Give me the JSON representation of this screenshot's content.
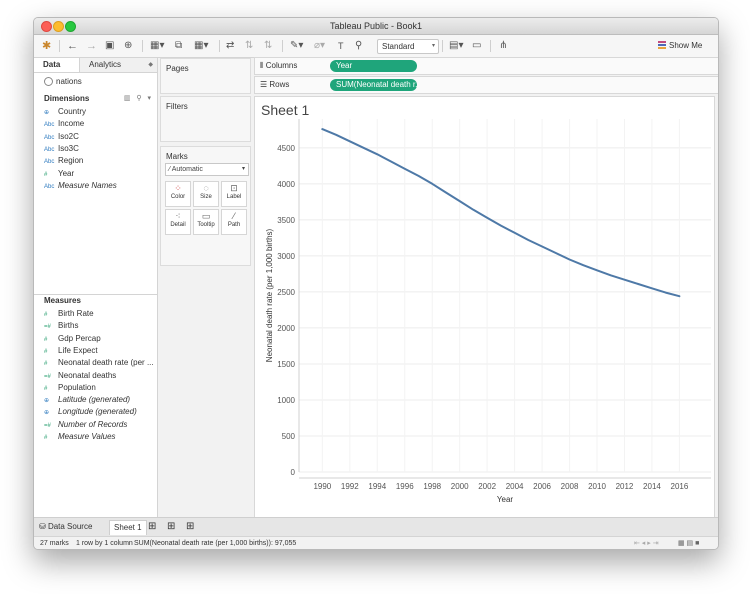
{
  "window": {
    "title": "Tableau Public - Book1"
  },
  "toolbar": {
    "view_size": "Standard",
    "show_me": "Show Me"
  },
  "data_pane": {
    "tabs": [
      "Data",
      "Analytics"
    ],
    "datasource": "nations",
    "dimensions_label": "Dimensions",
    "dimensions": [
      {
        "icon": "globe",
        "label": "Country"
      },
      {
        "icon": "Abc",
        "label": "Income"
      },
      {
        "icon": "Abc",
        "label": "Iso2C"
      },
      {
        "icon": "Abc",
        "label": "Iso3C"
      },
      {
        "icon": "Abc",
        "label": "Region"
      },
      {
        "icon": "#",
        "label": "Year"
      },
      {
        "icon": "Abc",
        "label": "Measure Names"
      }
    ],
    "measures_label": "Measures",
    "measures": [
      {
        "icon": "#",
        "label": "Birth Rate"
      },
      {
        "icon": "=#",
        "label": "Births"
      },
      {
        "icon": "#",
        "label": "Gdp Percap"
      },
      {
        "icon": "#",
        "label": "Life Expect"
      },
      {
        "icon": "#",
        "label": "Neonatal death rate (per ..."
      },
      {
        "icon": "=#",
        "label": "Neonatal deaths"
      },
      {
        "icon": "#",
        "label": "Population"
      },
      {
        "icon": "globe",
        "label": "Latitude (generated)"
      },
      {
        "icon": "globe",
        "label": "Longitude (generated)"
      },
      {
        "icon": "=#",
        "label": "Number of Records"
      },
      {
        "icon": "#",
        "label": "Measure Values"
      }
    ]
  },
  "cards": {
    "pages": "Pages",
    "filters": "Filters",
    "marks": "Marks",
    "mark_type": "Automatic",
    "buttons": [
      "Color",
      "Size",
      "Label",
      "Detail",
      "Tooltip",
      "Path"
    ]
  },
  "shelves": {
    "columns_label": "Columns",
    "columns_pill": "Year",
    "rows_label": "Rows",
    "rows_pill": "SUM(Neonatal death r.."
  },
  "sheet": {
    "title": "Sheet 1"
  },
  "chart_data": {
    "type": "line",
    "title": "",
    "xlabel": "Year",
    "ylabel": "Neonatal death rate (per 1,000 births)",
    "x_ticks": [
      "1990",
      "1992",
      "1994",
      "1996",
      "1998",
      "2000",
      "2002",
      "2004",
      "2006",
      "2008",
      "2010",
      "2012",
      "2014",
      "2016"
    ],
    "y_ticks": [
      "0",
      "500",
      "1000",
      "1500",
      "2000",
      "2500",
      "3000",
      "3500",
      "4000",
      "4500"
    ],
    "ylim": [
      0,
      4900
    ],
    "xlim": [
      1988.3,
      2018.3
    ],
    "series": [
      {
        "color": "#4e79a7",
        "x": [
          1990,
          1991,
          1992,
          1993,
          1994,
          1995,
          1996,
          1997,
          1998,
          1999,
          2000,
          2001,
          2002,
          2003,
          2004,
          2005,
          2006,
          2007,
          2008,
          2009,
          2010,
          2011,
          2012,
          2013,
          2014,
          2015,
          2016
        ],
        "values": [
          4760,
          4680,
          4590,
          4500,
          4410,
          4310,
          4210,
          4110,
          4000,
          3880,
          3760,
          3640,
          3530,
          3420,
          3320,
          3220,
          3130,
          3040,
          2950,
          2870,
          2800,
          2730,
          2670,
          2610,
          2550,
          2490,
          2440
        ]
      }
    ]
  },
  "tabs_bar": {
    "data_source": "Data Source",
    "sheet": "Sheet 1"
  },
  "status": {
    "marks": "27 marks",
    "dims": "1 row by 1 column",
    "sum": "SUM(Neonatal death rate (per 1,000 births)): 97,055"
  }
}
